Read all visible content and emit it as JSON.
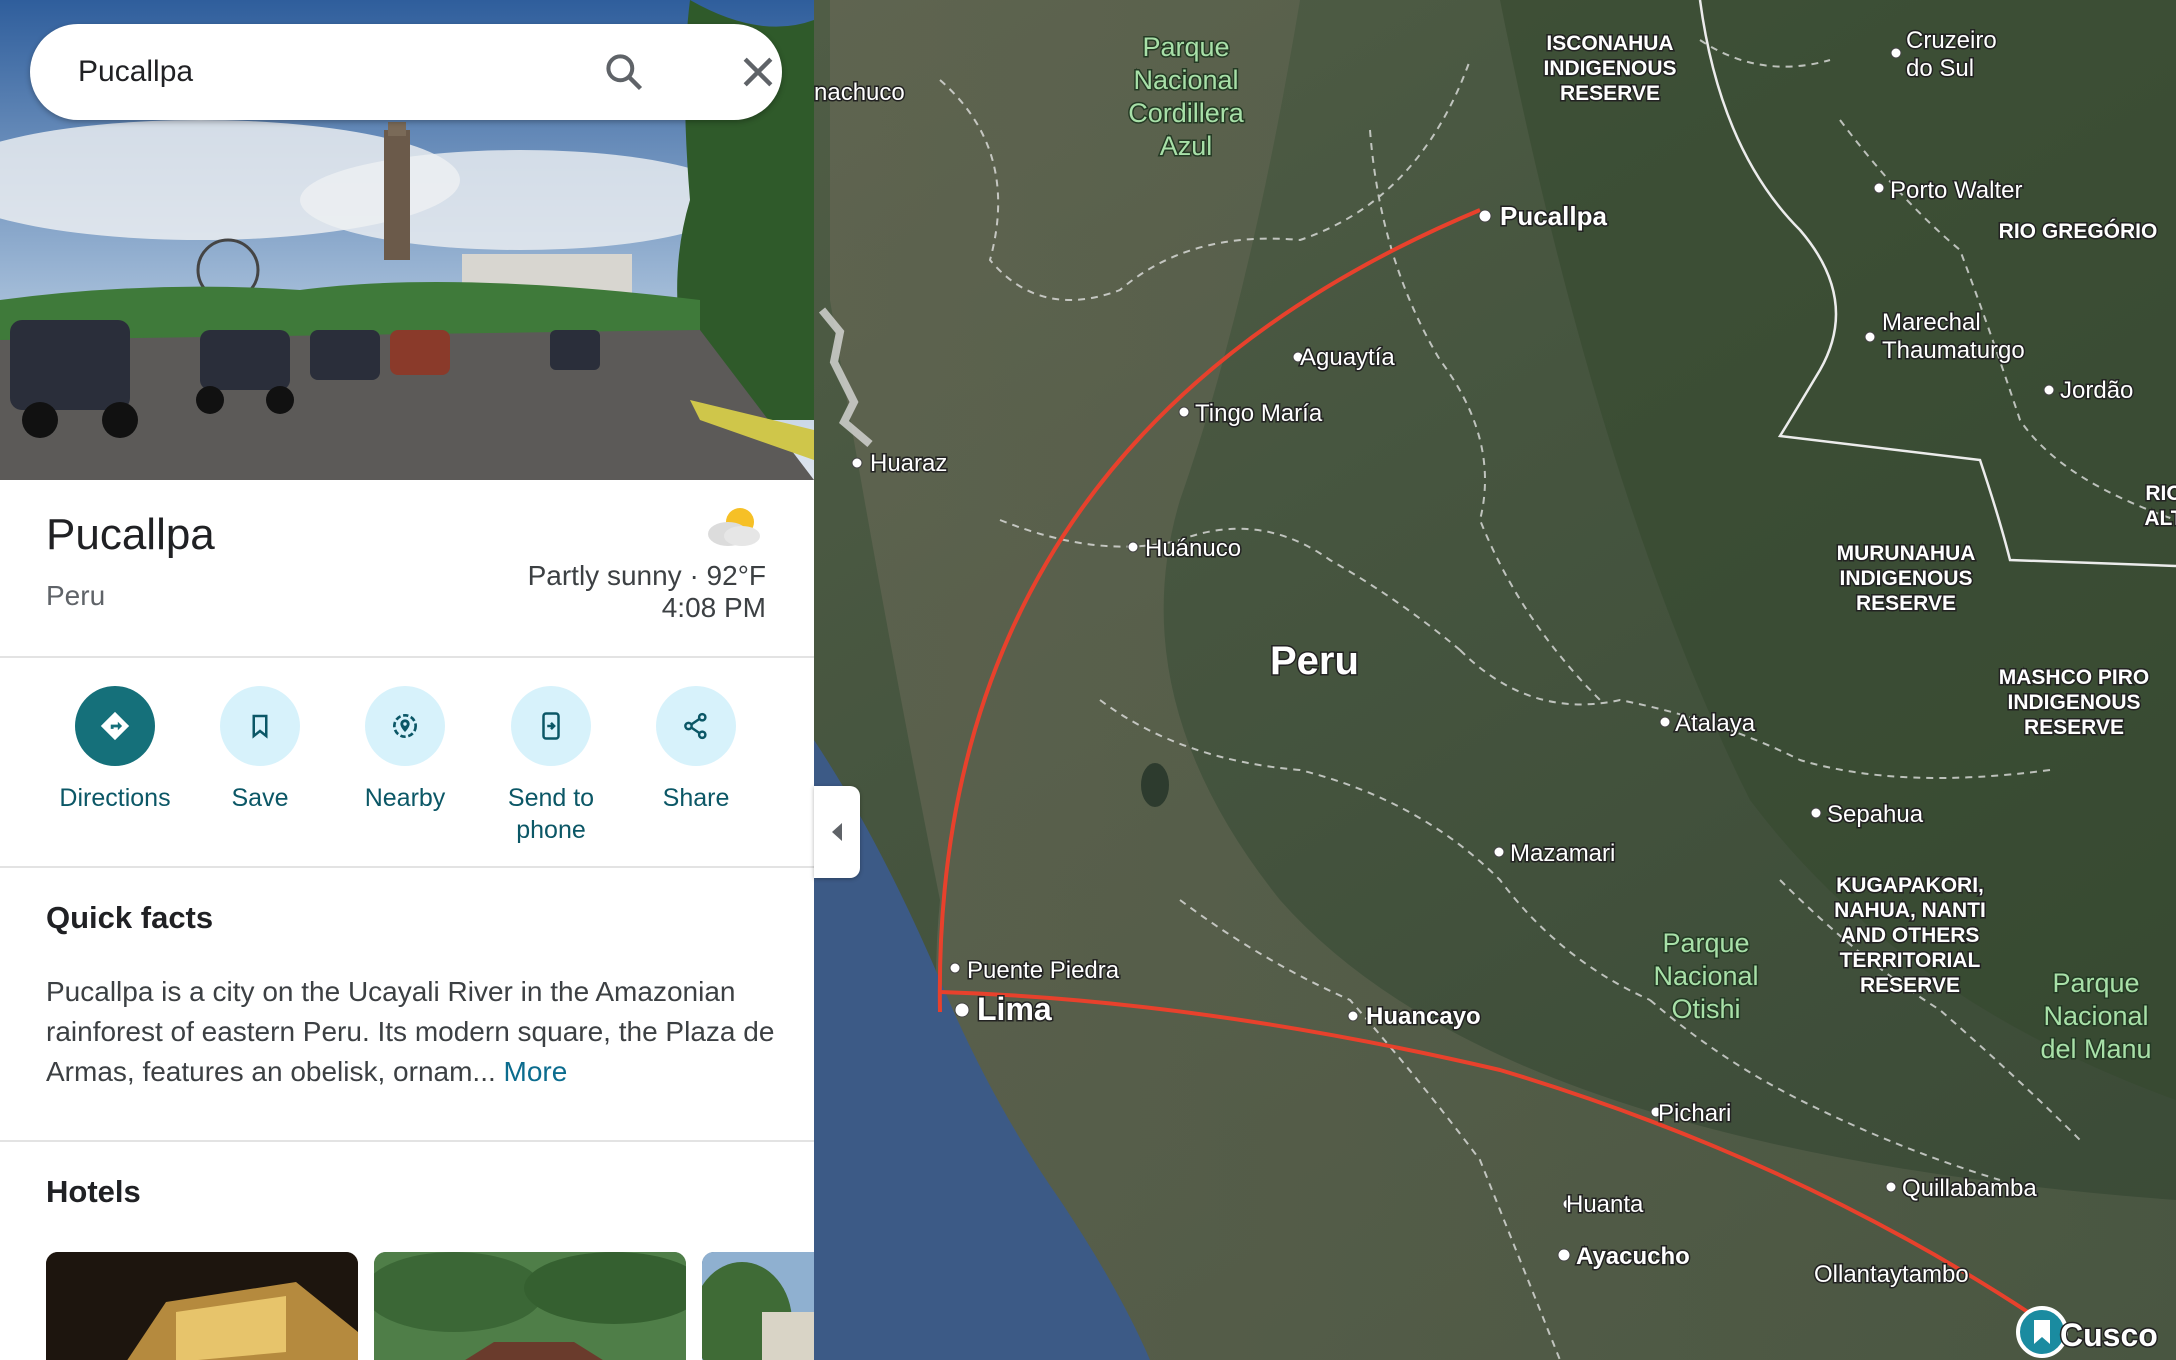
{
  "search": {
    "value": "Pucallpa"
  },
  "place": {
    "name": "Pucallpa",
    "country": "Peru",
    "weather": "Partly sunny · 92°F",
    "time": "4:08 PM"
  },
  "actions": [
    {
      "label": "Directions",
      "icon": "directions-icon"
    },
    {
      "label": "Save",
      "icon": "bookmark-icon"
    },
    {
      "label": "Nearby",
      "icon": "nearby-icon"
    },
    {
      "label": "Send to phone",
      "icon": "send-to-phone-icon"
    },
    {
      "label": "Share",
      "icon": "share-icon"
    }
  ],
  "quick_facts": {
    "heading": "Quick facts",
    "text": "Pucallpa is a city on the Ucayali River in the Amazonian rainforest of eastern Peru. Its modern square, the Plaza de Armas, features an obelisk, ornam...",
    "more": "More"
  },
  "hotels": {
    "heading": "Hotels"
  },
  "map": {
    "country_label": "Peru",
    "cities": [
      "Pucallpa",
      "Aguaytía",
      "Tingo María",
      "Huaraz",
      "Huánuco",
      "Atalaya",
      "Sepahua",
      "Mazamari",
      "Puente Piedra",
      "Lima",
      "Huancayo",
      "Pichari",
      "Huanta",
      "Ayacucho",
      "Quillabamba",
      "Ollantaytambo",
      "Cusco",
      "Cruzeiro do Sul",
      "Porto Walter",
      "Marechal Thaumaturgo",
      "Jordão",
      "nachuco"
    ],
    "reserves": [
      "ISCONAHUA INDIGENOUS RESERVE",
      "RIO GREGÓRIO",
      "MURUNAHUA INDIGENOUS RESERVE",
      "MASHCO PIRO INDIGENOUS RESERVE",
      "KUGAPAKORI, NAHUA, NANTI AND OTHERS TERRITORIAL RESERVE",
      "RIO ALT"
    ],
    "parks": [
      "Parque Nacional Cordillera Azul",
      "Parque Nacional Otishi",
      "Parque Nacional del Manu"
    ]
  },
  "colors": {
    "route": "#e8412c",
    "accent": "#15707a",
    "link": "#0b6c8e"
  }
}
